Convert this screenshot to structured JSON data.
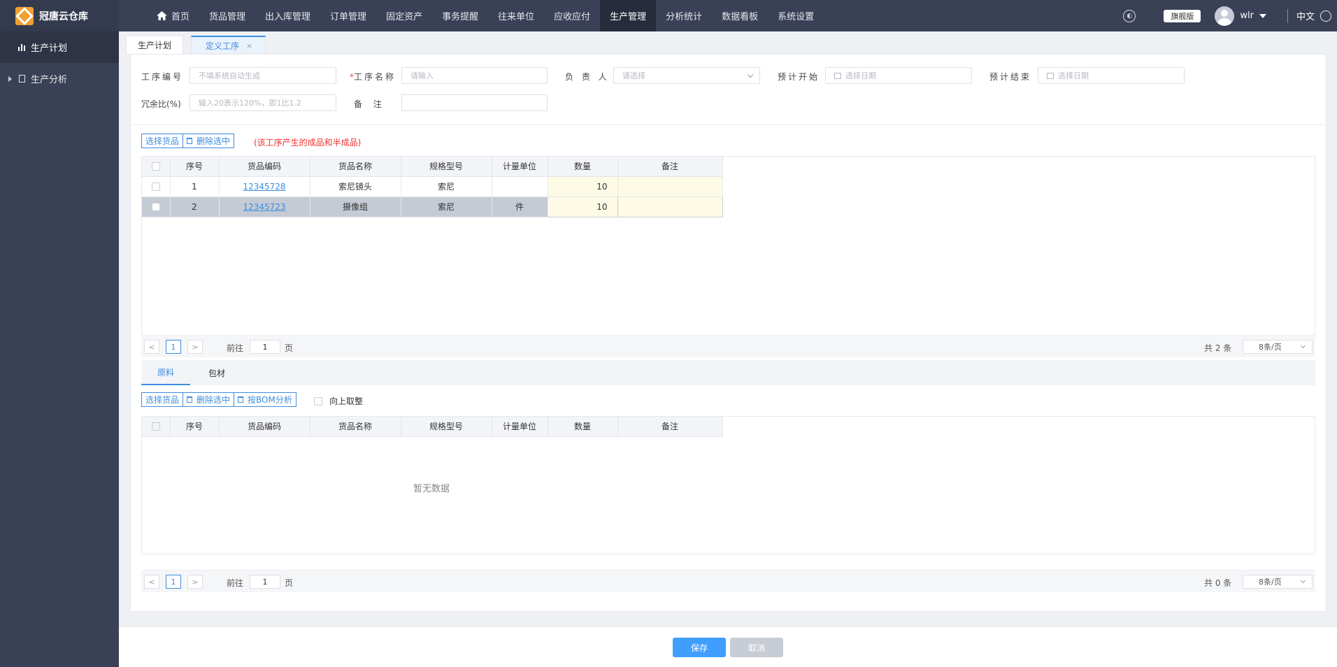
{
  "app": {
    "name": "冠唐云仓库"
  },
  "nav": {
    "items": [
      "首页",
      "货品管理",
      "出入库管理",
      "订单管理",
      "固定资产",
      "事务提醒",
      "往来单位",
      "应收应付",
      "生产管理",
      "分析统计",
      "数据看板",
      "系统设置"
    ],
    "active": "生产管理"
  },
  "topright": {
    "edition": "旗舰版",
    "username": "wlr",
    "language": "中文"
  },
  "sidebar": {
    "items": [
      {
        "label": "生产计划"
      },
      {
        "label": "生产分析"
      }
    ]
  },
  "tabs": [
    {
      "label": "生产计划"
    },
    {
      "label": "定义工序",
      "close": "×"
    }
  ],
  "form": {
    "process_no": {
      "label": "工序编号",
      "placeholder": "不填系统自动生成"
    },
    "process_name": {
      "label": "工序名称",
      "required_mark": "*",
      "placeholder": "请输入"
    },
    "owner": {
      "label": "负 责 人",
      "placeholder": "请选择"
    },
    "plan_start": {
      "label": "预计开始",
      "placeholder": "选择日期"
    },
    "plan_end": {
      "label": "预计结束",
      "placeholder": "选择日期"
    },
    "redundancy": {
      "label": "冗余比(%)",
      "placeholder": "输入20表示120%，即1比1.2"
    },
    "remark": {
      "label": "备 注",
      "placeholder": ""
    }
  },
  "products": {
    "buttons": {
      "select": "选择货品",
      "delete": "删除选中"
    },
    "note": "(该工序产生的成品和半成品)",
    "columns": [
      "序号",
      "货品编码",
      "货品名称",
      "规格型号",
      "计量单位",
      "数量",
      "备注"
    ],
    "rows": [
      {
        "no": "1",
        "code": "12345728",
        "name": "索尼镜头",
        "spec": "索尼",
        "unit": "",
        "qty": "10",
        "remark": ""
      },
      {
        "no": "2",
        "code": "12345723",
        "name": "摄像组",
        "spec": "索尼",
        "unit": "件",
        "qty": "10",
        "remark": ""
      }
    ],
    "pager": {
      "prev": "<",
      "page": "1",
      "next": ">",
      "goto_prefix": "前往",
      "goto_value": "1",
      "goto_suffix": "页",
      "total": "共 2 条",
      "page_size": "8条/页"
    }
  },
  "materials": {
    "tabs": [
      "原料",
      "包材"
    ],
    "active_tab": "原料",
    "buttons": {
      "select": "选择货品",
      "delete": "删除选中",
      "bom": "按BOM分析"
    },
    "round_up": "向上取整",
    "columns": [
      "序号",
      "货品编码",
      "货品名称",
      "规格型号",
      "计量单位",
      "数量",
      "备注"
    ],
    "empty": "暂无数据",
    "pager": {
      "prev": "<",
      "page": "1",
      "next": ">",
      "goto_prefix": "前往",
      "goto_value": "1",
      "goto_suffix": "页",
      "total": "共 0 条",
      "page_size": "8条/页"
    }
  },
  "footer": {
    "save": "保存",
    "cancel": "取消"
  }
}
